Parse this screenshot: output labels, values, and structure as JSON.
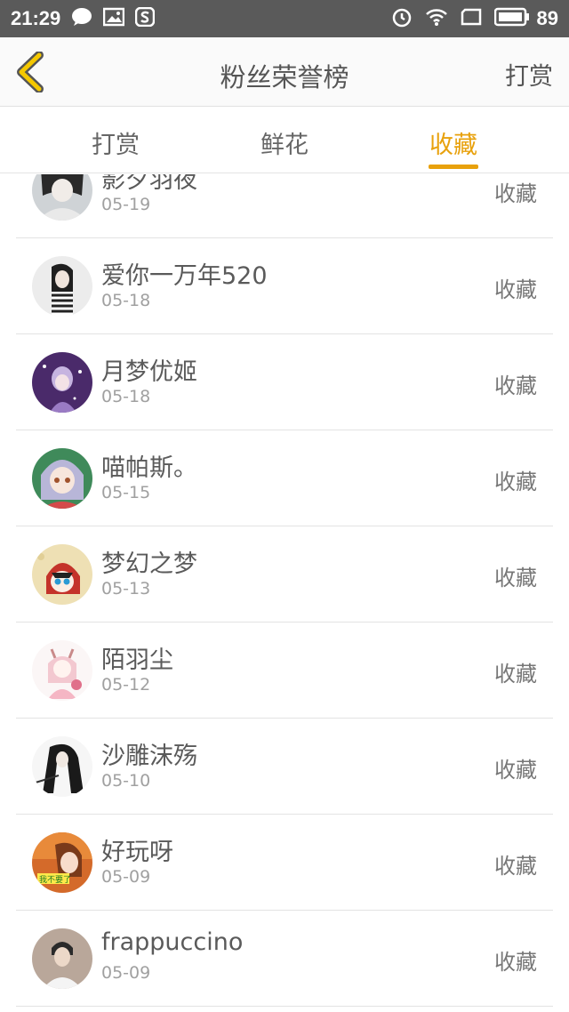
{
  "status_bar": {
    "time": "21:29",
    "battery": "89",
    "left_icons": [
      "chat-icon",
      "image-icon",
      "s-app-icon"
    ],
    "right_icons": [
      "alarm-icon",
      "wifi-icon",
      "screen-icon",
      "battery-icon"
    ]
  },
  "header": {
    "title": "粉丝荣誉榜",
    "action": "打赏",
    "back_icon": "chevron-left-icon",
    "accent": "#e8a10c"
  },
  "tabs": [
    {
      "label": "打赏",
      "active": false
    },
    {
      "label": "鲜花",
      "active": false
    },
    {
      "label": "收藏",
      "active": true
    }
  ],
  "list": {
    "rows": [
      {
        "name": "影夕羽夜",
        "date": "05-19",
        "action": "收藏"
      },
      {
        "name": "爱你一万年520",
        "date": "05-18",
        "action": "收藏"
      },
      {
        "name": "月梦优姬",
        "date": "05-18",
        "action": "收藏"
      },
      {
        "name": "喵帕斯。",
        "date": "05-15",
        "action": "收藏"
      },
      {
        "name": "梦幻之梦",
        "date": "05-13",
        "action": "收藏"
      },
      {
        "name": "陌羽尘",
        "date": "05-12",
        "action": "收藏"
      },
      {
        "name": "沙雕沫殇",
        "date": "05-10",
        "action": "收藏"
      },
      {
        "name": "好玩呀",
        "date": "05-09",
        "action": "收藏"
      },
      {
        "name": "frappuccino",
        "date": "05-09",
        "action": "收藏"
      }
    ]
  }
}
